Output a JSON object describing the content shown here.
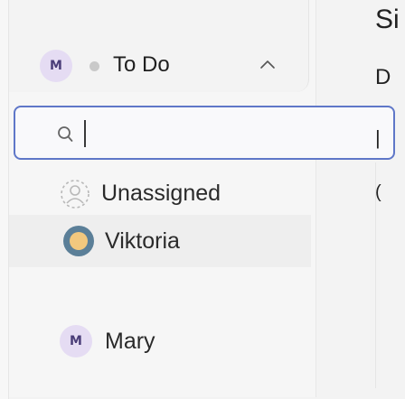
{
  "header": {
    "avatar_initial": "M",
    "title": "To Do"
  },
  "search": {
    "placeholder": ""
  },
  "options": [
    {
      "label": "Unassigned"
    },
    {
      "label": "Viktoria"
    },
    {
      "label": "Mary",
      "avatar_initial": "M"
    }
  ],
  "right_panel": {
    "line1": "Si",
    "line2": "D",
    "line3": "|",
    "line4": "("
  },
  "colors": {
    "accent": "#5f77c8",
    "avatar_bg": "#e5dcf3",
    "status_dot": "#c9c9c9"
  }
}
